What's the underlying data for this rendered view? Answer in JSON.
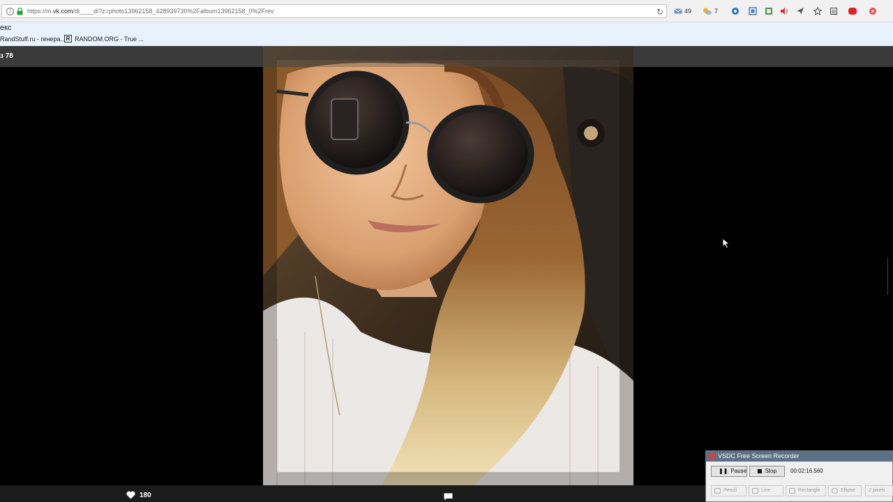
{
  "browser": {
    "url_prefix": "https://m.",
    "url_domain": "vk.com",
    "url_rest": "/di____di?z=photo13962158_428939730%2Falbum13962158_0%2Frev",
    "mail_count": "49",
    "weather_temp": "7"
  },
  "bookmarks": {
    "yandex_label": "екс",
    "items": [
      {
        "label": "RandStuff.ru - генера..."
      },
      {
        "label": "RANDOM.ORG - True ..."
      }
    ]
  },
  "viewer": {
    "counter": "з 78",
    "likes": "180"
  },
  "recorder": {
    "title": "VSDC Free Screen Recorder",
    "pause_label": "Pause",
    "stop_label": "Stop",
    "elapsed": "00:02:16.560",
    "tools": [
      {
        "label": "Pencil"
      },
      {
        "label": "Line"
      },
      {
        "label": "Rectangle"
      },
      {
        "label": "Ellipse"
      },
      {
        "label": "2 pixels"
      }
    ]
  }
}
